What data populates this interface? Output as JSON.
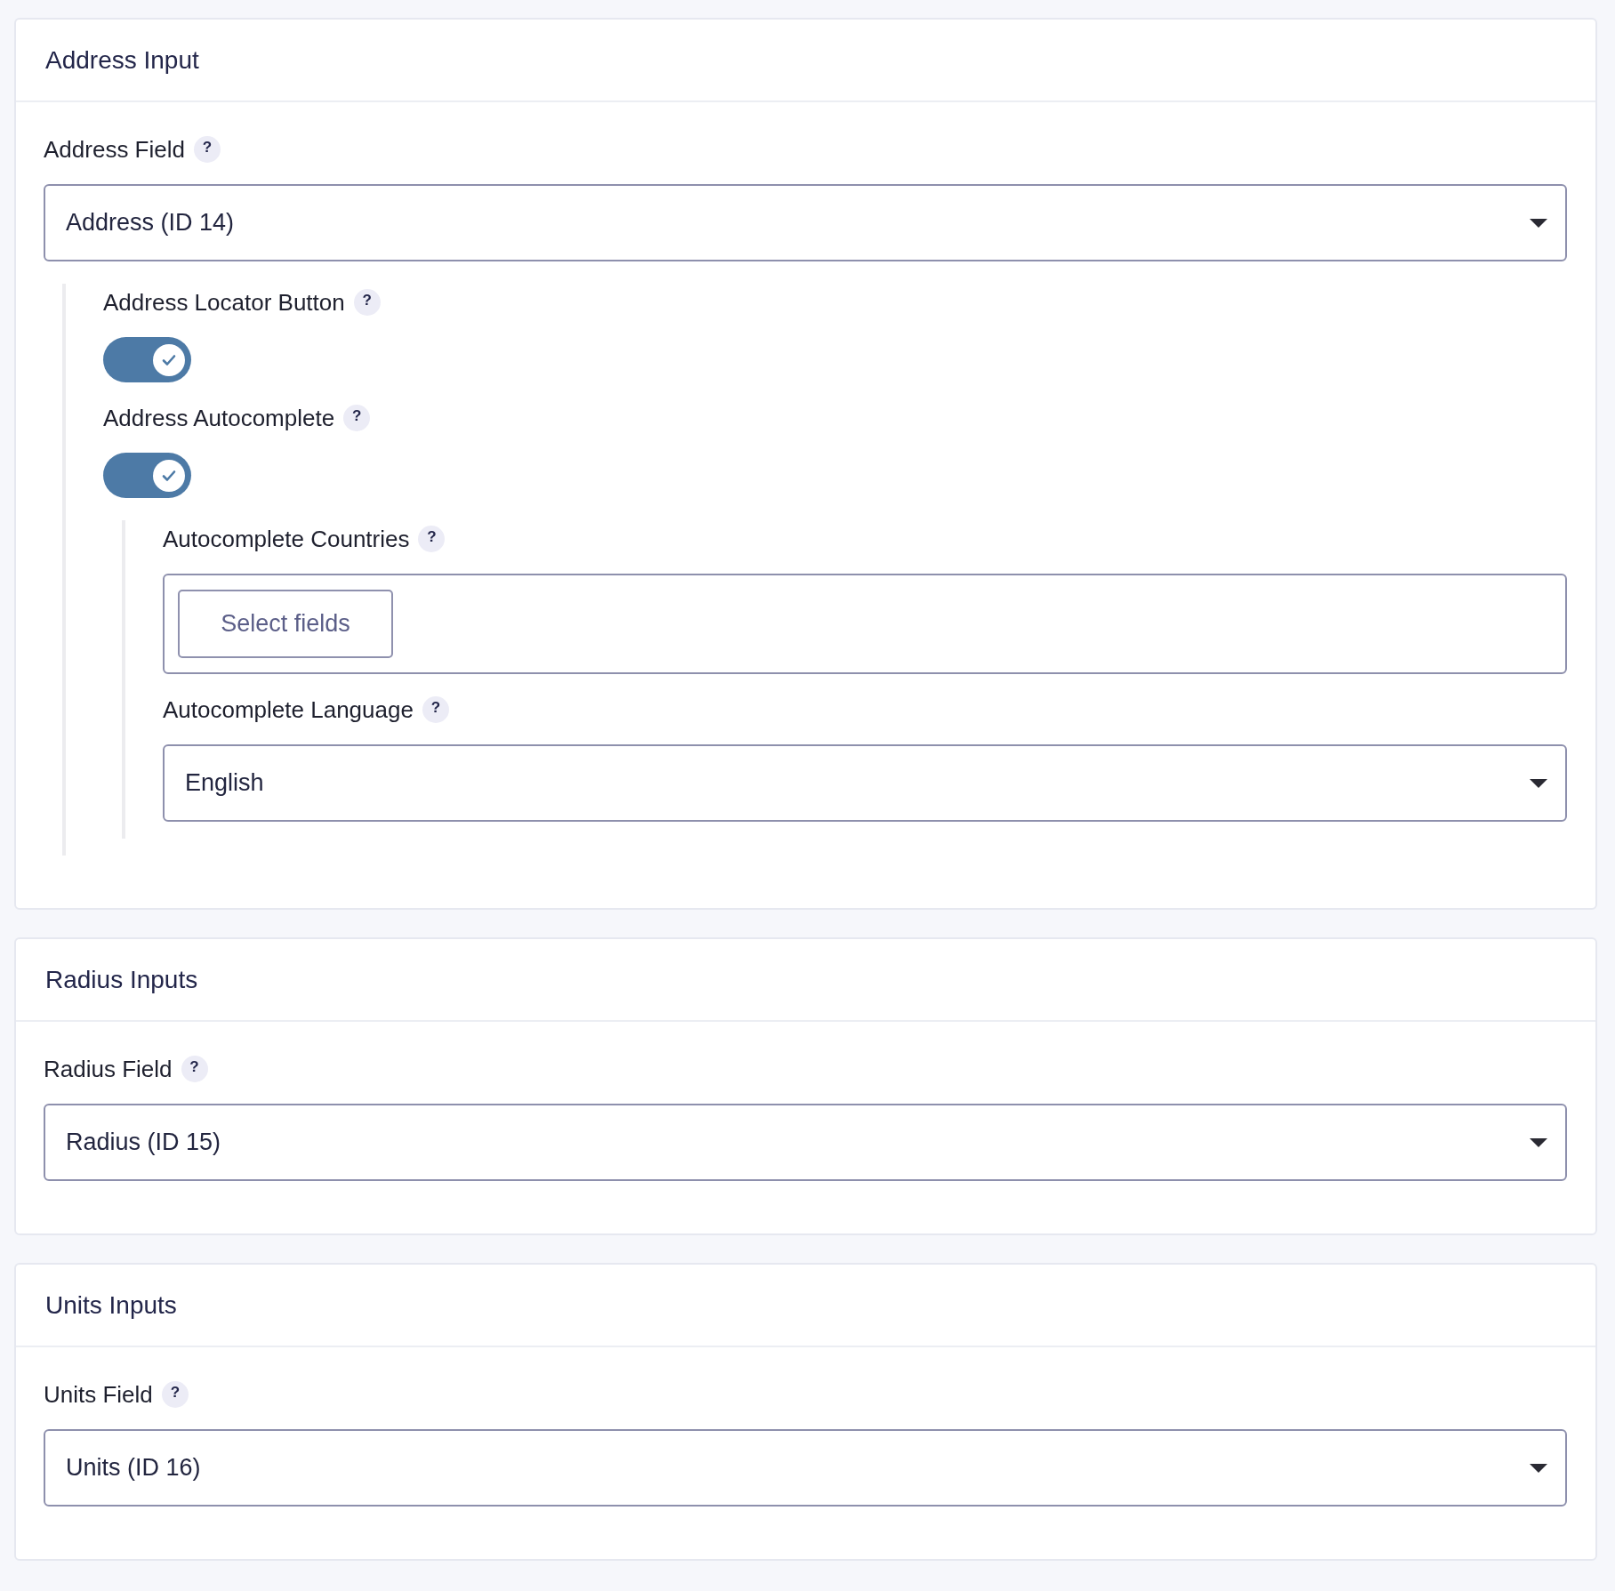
{
  "sections": [
    {
      "title": "Address Input",
      "fields": [
        {
          "kind": "select",
          "label": "Address Field",
          "help": "?",
          "value": "Address (ID 14)",
          "children": [
            {
              "kind": "toggle",
              "label": "Address Locator Button",
              "help": "?",
              "on": true
            },
            {
              "kind": "toggle",
              "label": "Address Autocomplete",
              "help": "?",
              "on": true,
              "children": [
                {
                  "kind": "multiselect",
                  "label": "Autocomplete Countries",
                  "help": "?",
                  "button": "Select fields"
                },
                {
                  "kind": "select",
                  "label": "Autocomplete Language",
                  "help": "?",
                  "value": "English"
                }
              ]
            }
          ]
        }
      ]
    },
    {
      "title": "Radius Inputs",
      "fields": [
        {
          "kind": "select",
          "label": "Radius Field",
          "help": "?",
          "value": "Radius (ID 15)"
        }
      ]
    },
    {
      "title": "Units Inputs",
      "fields": [
        {
          "kind": "select",
          "label": "Units Field",
          "help": "?",
          "value": "Units (ID 16)"
        }
      ]
    }
  ]
}
